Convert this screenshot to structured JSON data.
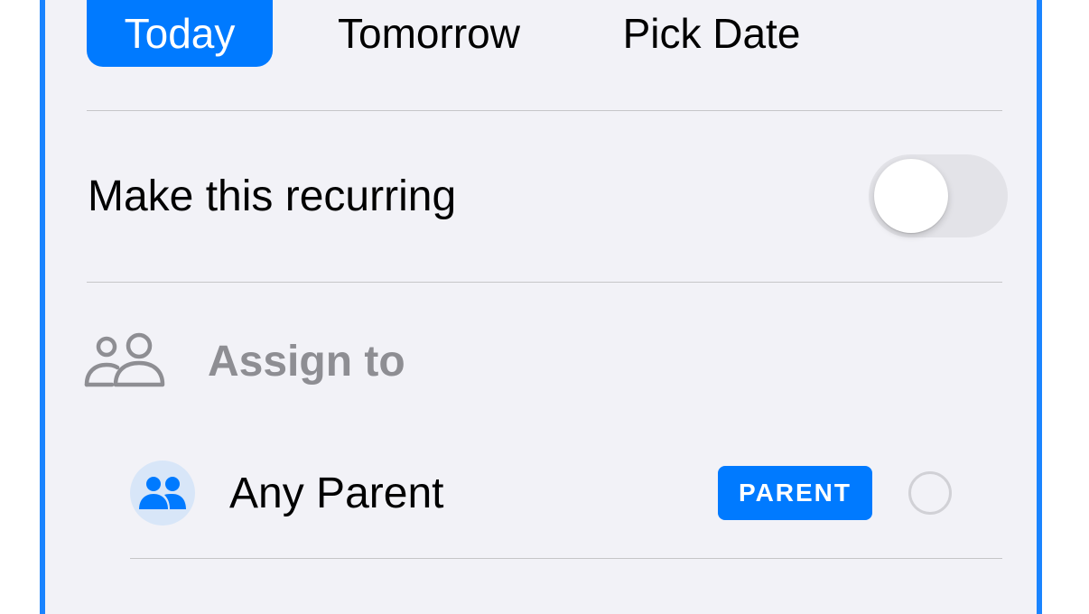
{
  "date_options": {
    "today": "Today",
    "tomorrow": "Tomorrow",
    "pick_date": "Pick Date",
    "selected": "Today"
  },
  "recurring": {
    "label": "Make this recurring",
    "enabled": false
  },
  "assign": {
    "heading": "Assign to",
    "icon": "people-outline-icon",
    "options": [
      {
        "label": "Any Parent",
        "badge": "PARENT",
        "icon": "people-filled-icon",
        "selected": false
      }
    ]
  },
  "colors": {
    "accent": "#007aff",
    "border": "#1a84ff",
    "background": "#f2f2f7",
    "secondary_text": "#8e8e93"
  }
}
